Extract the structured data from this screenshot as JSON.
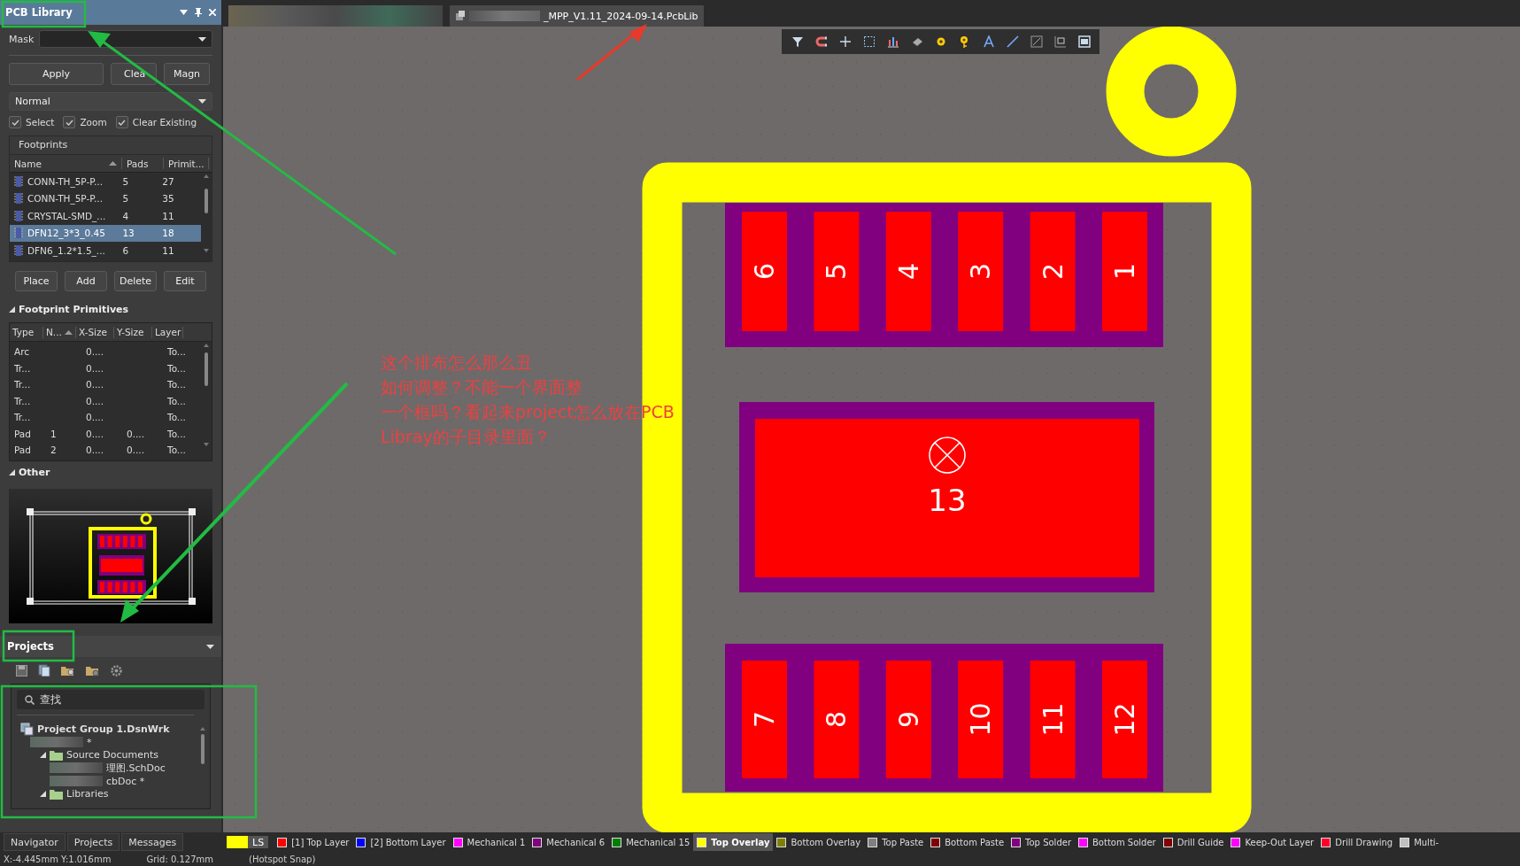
{
  "document_tabs": [
    {
      "kind": "redacted",
      "selected": false
    },
    {
      "kind": "file",
      "label": "_MPP_V1.11_2024-09-14.PcbLib",
      "selected": true
    }
  ],
  "pcb_library": {
    "title": "PCB Library",
    "mask_label": "Mask",
    "buttons": [
      "Apply",
      "Clea",
      "Magn"
    ],
    "mode": "Normal",
    "options": [
      {
        "label": "Select",
        "checked": true
      },
      {
        "label": "Zoom",
        "checked": true
      },
      {
        "label": "Clear Existing",
        "checked": true
      }
    ],
    "footprints": {
      "title": "Footprints",
      "columns": [
        "Name",
        "Pads",
        "Primit..."
      ],
      "rows": [
        {
          "cells": [
            "CONN-TH_5P-P...",
            "5",
            "27"
          ],
          "selected": false
        },
        {
          "cells": [
            "CONN-TH_5P-P...",
            "5",
            "35"
          ],
          "selected": false
        },
        {
          "cells": [
            "CRYSTAL-SMD_...",
            "4",
            "11"
          ],
          "selected": false
        },
        {
          "cells": [
            "DFN12_3*3_0.45",
            "13",
            "18"
          ],
          "selected": true
        },
        {
          "cells": [
            "DFN6_1.2*1.5_...",
            "6",
            "11"
          ],
          "selected": false
        }
      ]
    },
    "actions": [
      "Place",
      "Add",
      "Delete",
      "Edit"
    ],
    "primitives": {
      "title": "Footprint Primitives",
      "expanded": true,
      "columns": [
        "Type",
        "N...",
        "X-Size",
        "Y-Size",
        "Layer"
      ],
      "rows": [
        [
          "Arc",
          "",
          "0....",
          "",
          "To..."
        ],
        [
          "Tr...",
          "",
          "0....",
          "",
          "To..."
        ],
        [
          "Tr...",
          "",
          "0....",
          "",
          "To..."
        ],
        [
          "Tr...",
          "",
          "0....",
          "",
          "To..."
        ],
        [
          "Tr...",
          "",
          "0....",
          "",
          "To..."
        ],
        [
          "Pad",
          "1",
          "0....",
          "0....",
          "To..."
        ],
        [
          "Pad",
          "2",
          "0....",
          "0....",
          "To..."
        ]
      ]
    },
    "other": {
      "title": "Other",
      "expanded": true
    }
  },
  "projects": {
    "title": "Projects",
    "search_placeholder": "查找",
    "tree": [
      {
        "label": "Project Group 1.DsnWrk",
        "kind": "group",
        "children": [
          {
            "label": "*",
            "kind": "redacted",
            "children": [
              {
                "label": "Source Documents",
                "kind": "folder",
                "expanded": true,
                "children": [
                  {
                    "label": "理图.SchDoc",
                    "kind": "redacted"
                  },
                  {
                    "label": "cbDoc *",
                    "kind": "redacted"
                  }
                ]
              },
              {
                "label": "Libraries",
                "kind": "folder",
                "expanded": true
              }
            ]
          }
        ]
      }
    ]
  },
  "panel_tabs": [
    "Navigator",
    "Projects",
    "Messages"
  ],
  "layers": {
    "current_label": "LS",
    "items": [
      {
        "name": "[1] Top Layer",
        "color": "#ff0000",
        "selected": false
      },
      {
        "name": "[2] Bottom Layer",
        "color": "#0000ff",
        "selected": false
      },
      {
        "name": "Mechanical 1",
        "color": "#ff00ff",
        "selected": false
      },
      {
        "name": "Mechanical 6",
        "color": "#800080",
        "selected": false
      },
      {
        "name": "Mechanical 15",
        "color": "#008000",
        "selected": false
      },
      {
        "name": "Top Overlay",
        "color": "#ffff00",
        "selected": true
      },
      {
        "name": "Bottom Overlay",
        "color": "#808000",
        "selected": false
      },
      {
        "name": "Top Paste",
        "color": "#808080",
        "selected": false
      },
      {
        "name": "Bottom Paste",
        "color": "#800000",
        "selected": false
      },
      {
        "name": "Top Solder",
        "color": "#800080",
        "selected": false
      },
      {
        "name": "Bottom Solder",
        "color": "#ff00ff",
        "selected": false
      },
      {
        "name": "Drill Guide",
        "color": "#800000",
        "selected": false
      },
      {
        "name": "Keep-Out Layer",
        "color": "#ff00ff",
        "selected": false
      },
      {
        "name": "Drill Drawing",
        "color": "#ff002a",
        "selected": false
      },
      {
        "name": "Multi-",
        "color": "#c0c0c0",
        "selected": false
      }
    ]
  },
  "status_bar": [
    "X:-4.445mm Y:1.016mm",
    "Grid: 0.127mm",
    "(Hotspot Snap)"
  ],
  "canvas": {
    "top_pads": [
      "6",
      "5",
      "4",
      "3",
      "2",
      "1"
    ],
    "center_pad": "13",
    "bottom_pads": [
      "7",
      "8",
      "9",
      "10",
      "11",
      "12"
    ]
  },
  "annotation": {
    "lines": [
      "这个排布怎么那么丑",
      "如何调整？不能一个界面整",
      "一个框吗？看起来project怎么放在PCB",
      "Libray的子目录里面？"
    ]
  }
}
